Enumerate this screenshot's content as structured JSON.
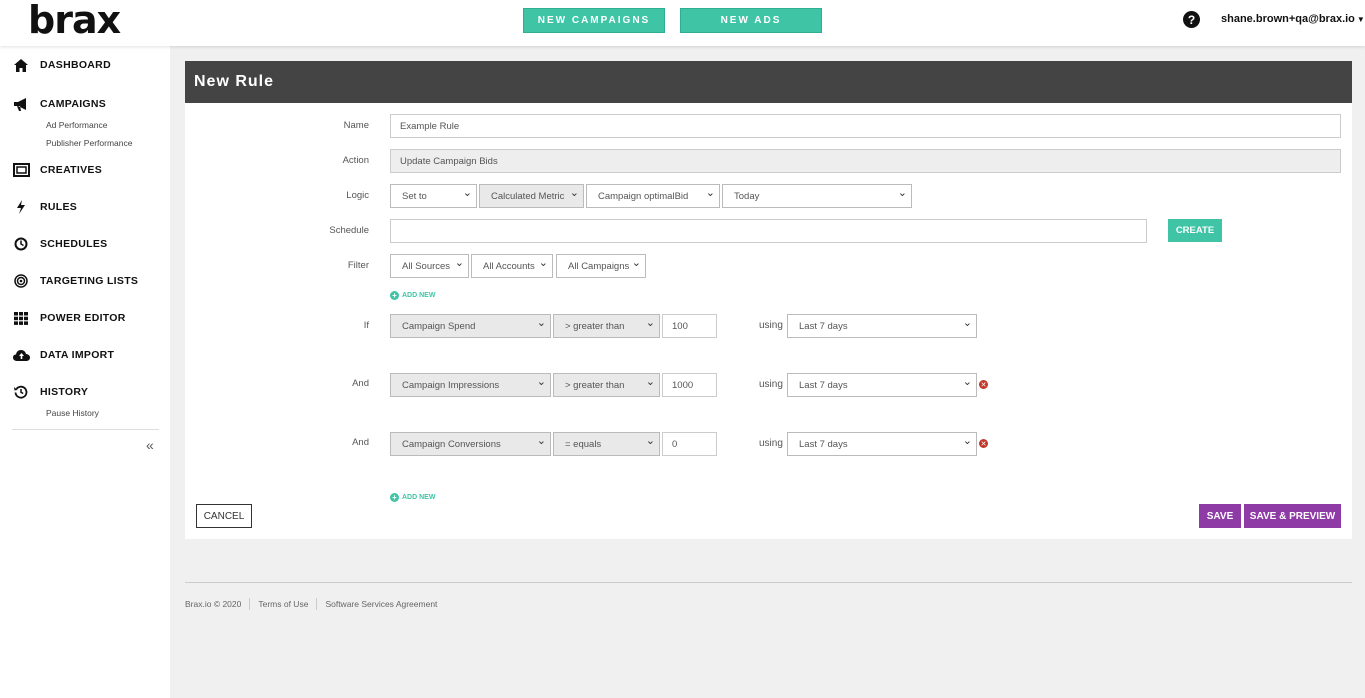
{
  "header": {
    "logo": "brax",
    "new_campaigns": "NEW CAMPAIGNS",
    "new_ads": "NEW ADS",
    "help_icon": "question-circle-icon",
    "user": "shane.brown+qa@brax.io"
  },
  "sidebar": {
    "dashboard": "DASHBOARD",
    "campaigns": "CAMPAIGNS",
    "ad_performance": "Ad Performance",
    "publisher_performance": "Publisher Performance",
    "creatives": "CREATIVES",
    "rules": "RULES",
    "schedules": "SCHEDULES",
    "targeting_lists": "TARGETING LISTS",
    "power_editor": "POWER EDITOR",
    "data_import": "DATA IMPORT",
    "history": "HISTORY",
    "pause_history": "Pause History",
    "collapse": "«"
  },
  "form": {
    "title": "New Rule",
    "name_label": "Name",
    "name_value": "Example Rule",
    "action_label": "Action",
    "action_value": "Update Campaign Bids",
    "logic_label": "Logic",
    "logic_op": "Set to",
    "logic_type": "Calculated Metric",
    "logic_metric": "Campaign optimalBid",
    "logic_period": "Today",
    "schedule_label": "Schedule",
    "create": "CREATE",
    "filter_label": "Filter",
    "filter_sources": "All Sources",
    "filter_accounts": "All Accounts",
    "filter_campaigns": "All Campaigns",
    "add_new": "ADD NEW",
    "using": "using",
    "conditions": [
      {
        "label": "If",
        "metric": "Campaign Spend",
        "op": "> greater than",
        "value": "100",
        "period": "Last 7 days"
      },
      {
        "label": "And",
        "metric": "Campaign Impressions",
        "op": "> greater than",
        "value": "1000",
        "period": "Last 7 days"
      },
      {
        "label": "And",
        "metric": "Campaign Conversions",
        "op": "= equals",
        "value": "0",
        "period": "Last 7 days"
      }
    ],
    "cancel": "CANCEL",
    "save": "SAVE",
    "save_preview": "SAVE & PREVIEW"
  },
  "footer": {
    "copyright": "Brax.io © 2020",
    "terms": "Terms of Use",
    "ssa": "Software Services Agreement"
  }
}
